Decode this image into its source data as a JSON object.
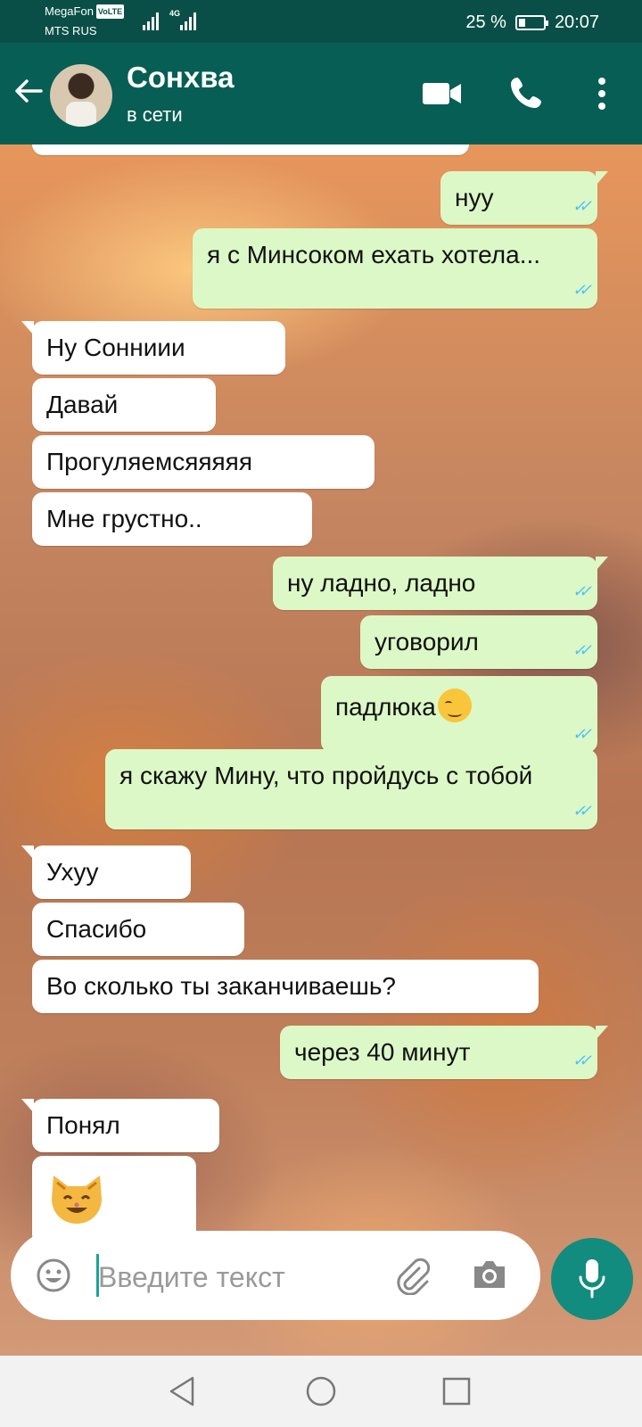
{
  "status_bar": {
    "carrier_1": "MegaFon",
    "volte": "VoLTE",
    "carrier_2": "MTS RUS",
    "network": "4G",
    "battery_percent": "25 %",
    "time": "20:07"
  },
  "header": {
    "contact_name": "Сонхва",
    "contact_status": "в сети"
  },
  "messages": [
    {
      "dir": "out",
      "text": "нуу",
      "status": "read"
    },
    {
      "dir": "out",
      "text": "я с Минсоком ехать хотела...",
      "status": "read"
    },
    {
      "dir": "in",
      "text": "Ну Сонниии"
    },
    {
      "dir": "in",
      "text": "Давай"
    },
    {
      "dir": "in",
      "text": "Прогуляемсяяяяя"
    },
    {
      "dir": "in",
      "text": "Мне грустно.."
    },
    {
      "dir": "out",
      "text": "ну ладно, ладно",
      "status": "read"
    },
    {
      "dir": "out",
      "text": "уговорил",
      "status": "read"
    },
    {
      "dir": "out",
      "text": "падлюка",
      "emoji": "smirk-emoji",
      "status": "read"
    },
    {
      "dir": "out",
      "text": "я скажу Мину, что пройдусь с тобой",
      "status": "read"
    },
    {
      "dir": "in",
      "text": "Ухуу"
    },
    {
      "dir": "in",
      "text": "Спасибо"
    },
    {
      "dir": "in",
      "text": "Во сколько ты заканчиваешь?"
    },
    {
      "dir": "out",
      "text": "через 40 минут",
      "status": "read"
    },
    {
      "dir": "in",
      "text": "Понял"
    },
    {
      "dir": "in",
      "text": "",
      "emoji": "cat-smile-emoji"
    }
  ],
  "composer": {
    "placeholder": "Введите текст"
  },
  "colors": {
    "header": "#075e54",
    "status_bar": "#0a4f47",
    "outgoing_bubble": "#dcf8c6",
    "incoming_bubble": "#ffffff",
    "read_ticks": "#4fc3f7",
    "mic_button": "#128c7e"
  },
  "icons": [
    "back-arrow-icon",
    "video-call-icon",
    "phone-icon",
    "more-icon",
    "emoji-icon",
    "attach-icon",
    "camera-icon",
    "mic-icon",
    "nav-back-icon",
    "nav-home-icon",
    "nav-recents-icon"
  ]
}
